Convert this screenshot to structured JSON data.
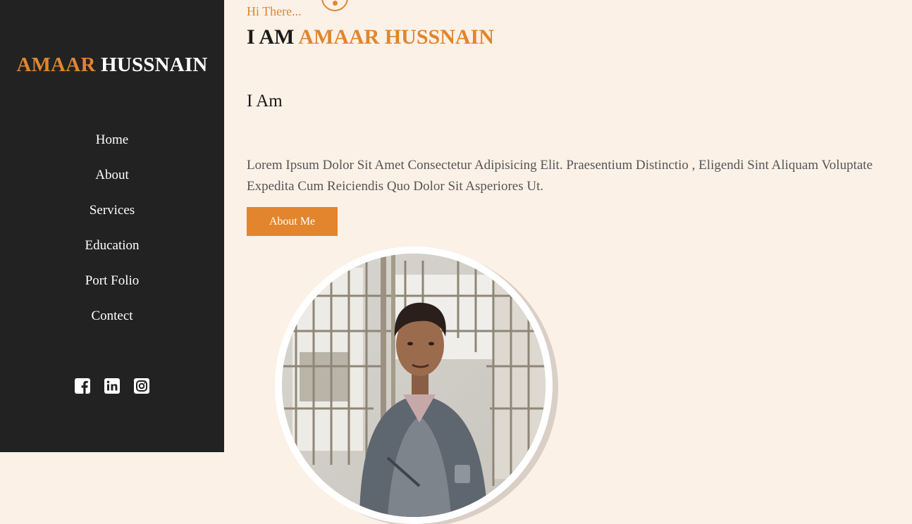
{
  "sidebar": {
    "logo_first": "AMAAR",
    "logo_last": "HUSSNAIN",
    "nav": [
      "Home",
      "About",
      "Services",
      "Education",
      "Port Folio",
      "Contect"
    ],
    "social_icons": [
      "facebook-icon",
      "linkedin-icon",
      "instagram-icon"
    ]
  },
  "hero": {
    "greeting": "Hi There...",
    "headline_prefix": "I AM",
    "headline_name": "AMAAR HUSSNAIN",
    "typed_text": "I Am",
    "description": "Lorem Ipsum Dolor Sit Amet Consectetur Adipisicing Elit. Praesentium Distinctio , Eligendi Sint Aliquam Voluptate Expedita Cum Reiciendis Quo Dolor Sit Asperiores Ut.",
    "button_label": "About Me"
  },
  "colors": {
    "accent": "#e2852c",
    "sidebar_bg": "#222222",
    "page_bg": "#fcf1e7"
  }
}
